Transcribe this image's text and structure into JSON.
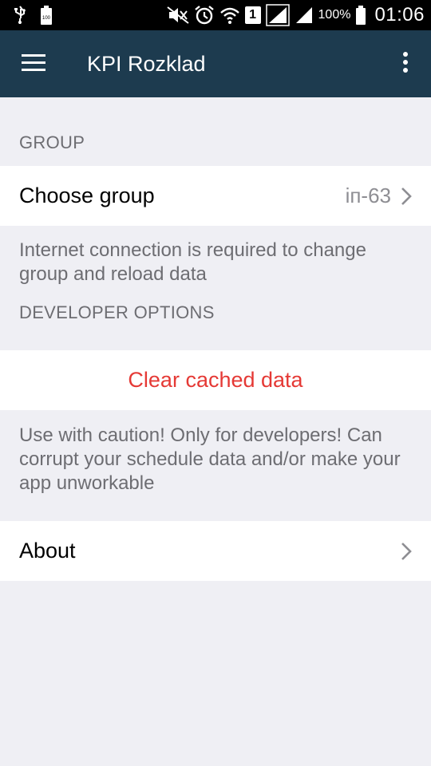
{
  "status_bar": {
    "battery_percent": "100%",
    "time": "01:06",
    "sim_slot": "1"
  },
  "app_bar": {
    "title": "KPI Rozklad"
  },
  "group_section": {
    "header": "GROUP",
    "choose_group_label": "Choose group",
    "choose_group_value": "іп-63",
    "footer": "Internet connection is required to change group and reload data"
  },
  "developer_section": {
    "header": "DEVELOPER OPTIONS",
    "clear_cache_label": "Clear cached data",
    "footer": "Use with caution! Only for developers! Can corrupt your schedule data and/or make your app unworkable"
  },
  "about_section": {
    "about_label": "About"
  },
  "colors": {
    "app_bar": "#1d3b4f",
    "background": "#efeff4",
    "destructive": "#e53935",
    "secondary_text": "#6d6d72",
    "value_text": "#8e8e93"
  }
}
